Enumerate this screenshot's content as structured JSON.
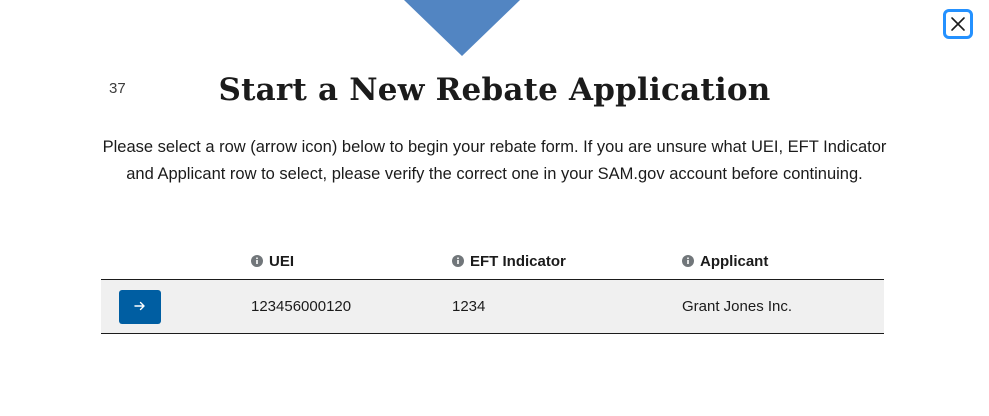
{
  "modal": {
    "step_number": "37",
    "title": "Start a New Rebate Application",
    "intro": "Please select a row (arrow icon) below to begin your rebate form. If you are unsure what UEI, EFT Indicator and Applicant row to select, please verify the correct one in your SAM.gov account before continuing.",
    "close_icon": "close-icon",
    "accent_color": "#005ea2",
    "focus_color": "#2491ff"
  },
  "table": {
    "headers": {
      "uei": "UEI",
      "eft": "EFT Indicator",
      "applicant": "Applicant"
    },
    "header_icon": "info-icon",
    "rows": [
      {
        "action_icon": "arrow-right-icon",
        "uei": "123456000120",
        "eft": "1234",
        "applicant": "Grant Jones Inc."
      }
    ]
  }
}
